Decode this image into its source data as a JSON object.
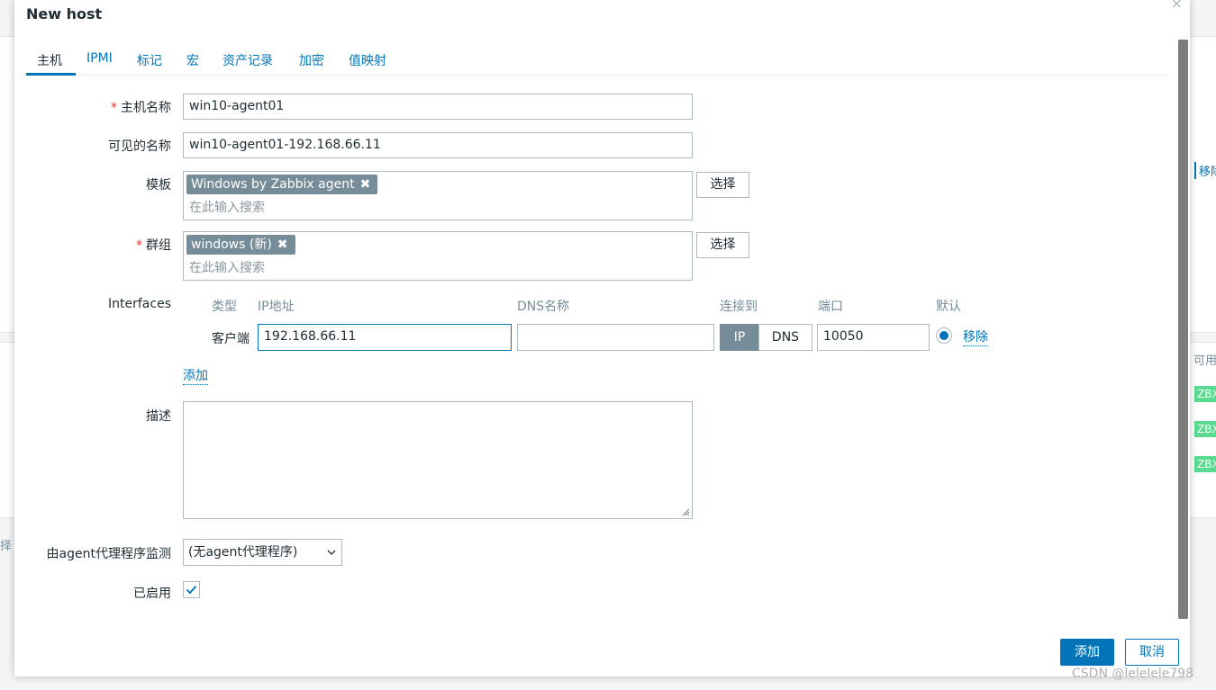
{
  "background": {
    "remove_link": "移除",
    "available_header": "可用",
    "badges": [
      "ZBX",
      "ZBX",
      "ZBX"
    ],
    "left_fragment": "择"
  },
  "dialog": {
    "title": "New host",
    "close_label": "×",
    "tabs": [
      {
        "label": "主机",
        "active": true
      },
      {
        "label": "IPMI"
      },
      {
        "label": "标记"
      },
      {
        "label": "宏"
      },
      {
        "label": "资产记录"
      },
      {
        "label": "加密"
      },
      {
        "label": "值映射"
      }
    ],
    "form": {
      "host_name": {
        "label": "主机名称",
        "value": "win10-agent01",
        "required": true
      },
      "visible_name": {
        "label": "可见的名称",
        "value": "win10-agent01-192.168.66.11"
      },
      "templates": {
        "label": "模板",
        "items": [
          "Windows by Zabbix agent"
        ],
        "placeholder": "在此输入搜索",
        "select_button": "选择"
      },
      "groups": {
        "label": "群组",
        "items": [
          "windows (新)"
        ],
        "placeholder": "在此输入搜索",
        "select_button": "选择",
        "required": true
      },
      "interfaces": {
        "label": "Interfaces",
        "headers": {
          "type": "类型",
          "ip": "IP地址",
          "dns": "DNS名称",
          "connect": "连接到",
          "port": "端口",
          "default": "默认"
        },
        "rows": [
          {
            "type": "客户端",
            "ip": "192.168.66.11",
            "dns": "",
            "connect_ip": "IP",
            "connect_dns": "DNS",
            "connect_selected": "IP",
            "port": "10050",
            "default": true,
            "remove": "移除"
          }
        ],
        "add_link": "添加"
      },
      "description": {
        "label": "描述",
        "value": ""
      },
      "proxy": {
        "label": "由agent代理程序监测",
        "value": "(无agent代理程序)"
      },
      "enabled": {
        "label": "已启用",
        "checked": true
      }
    },
    "buttons": {
      "add": "添加",
      "cancel": "取消"
    }
  },
  "watermark": "CSDN @lelelele798",
  "colors": {
    "accent": "#0275b8",
    "chip": "#768d99",
    "required": "#e33734",
    "badge": "#59db8f"
  }
}
